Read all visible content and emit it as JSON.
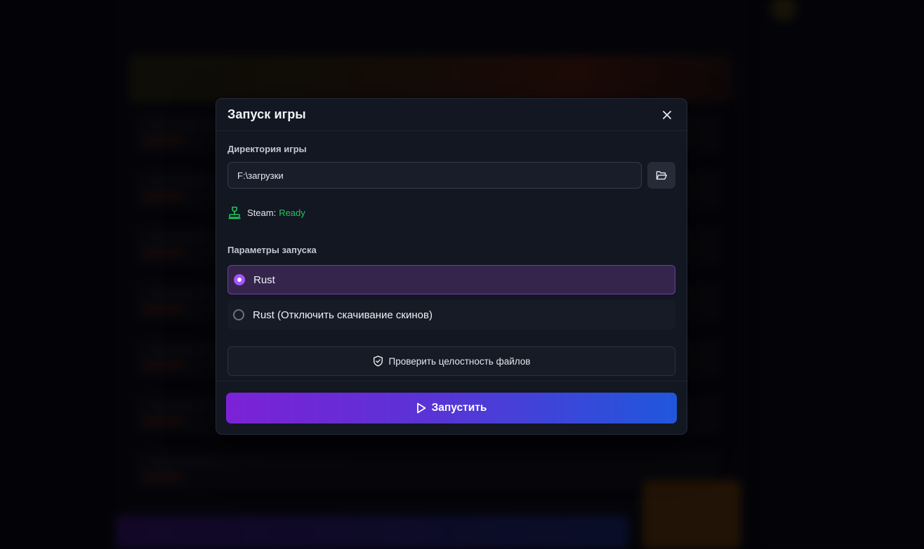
{
  "modal": {
    "title": "Запуск игры",
    "directory_label": "Директория игры",
    "directory_value": "F:\\загрузки",
    "steam": {
      "label": "Steam:",
      "status": "Ready",
      "status_color": "#22c55e"
    },
    "params_label": "Параметры запуска",
    "options": [
      {
        "label": "Rust",
        "selected": true
      },
      {
        "label": "Rust (Отключить скачивание скинов)",
        "selected": false
      }
    ],
    "verify_label": "Проверить целостность файлов",
    "launch_label": "Запустить"
  },
  "colors": {
    "accent_purple": "#a855f7",
    "launch_gradient_start": "#7c22d6",
    "launch_gradient_end": "#2057dc"
  },
  "icons": {
    "close": "close-icon",
    "folder": "folder-open-icon",
    "steam": "joystick-icon",
    "verify": "shield-check-icon",
    "launch": "play-icon"
  }
}
